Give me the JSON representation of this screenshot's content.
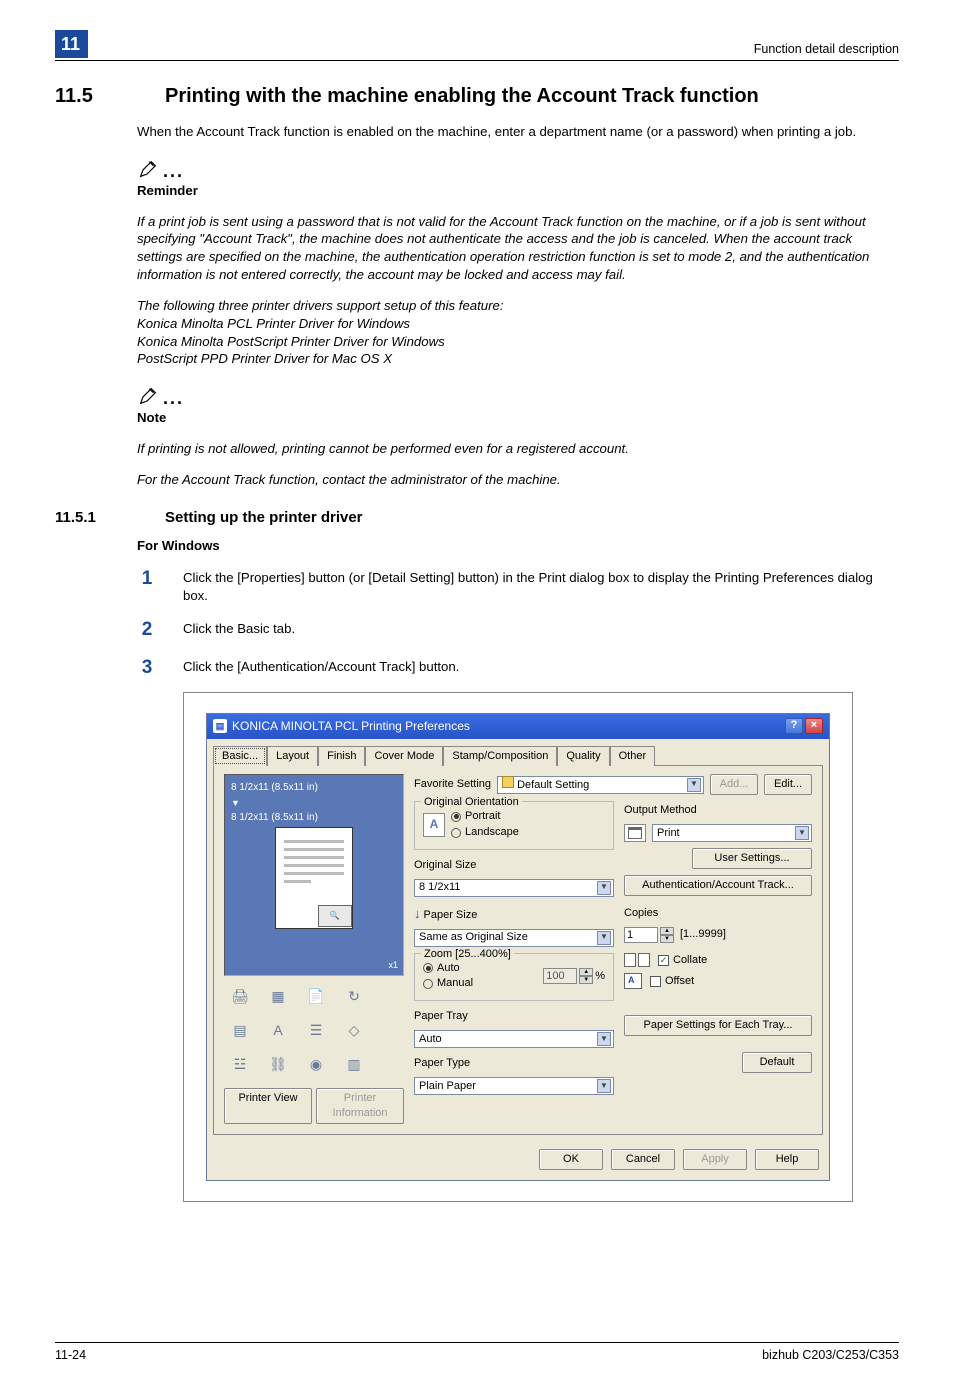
{
  "header": {
    "chapter": "11",
    "right": "Function detail description"
  },
  "sec": {
    "num": "11.5",
    "title": "Printing with the machine enabling the Account Track function",
    "intro": "When the Account Track function is enabled on the machine, enter a department name (or a password) when printing a job."
  },
  "reminder": {
    "label": "Reminder",
    "p1": "If a print job is sent using a password that is not valid for the Account Track function on the machine, or if a job is sent without specifying \"Account Track\", the machine does not authenticate the access and the job is canceled. When the account track settings are specified on the machine, the authentication operation restriction function is set to mode 2, and the authentication information is not entered correctly, the account may be locked and access may fail.",
    "p2": "The following three printer drivers support setup of this feature:",
    "d1": "Konica Minolta PCL Printer Driver for Windows",
    "d2": "Konica Minolta PostScript Printer Driver for Windows",
    "d3": "PostScript PPD Printer Driver for Mac OS X"
  },
  "note": {
    "label": "Note",
    "p1": "If printing is not allowed, printing cannot be performed even for a registered account.",
    "p2": "For the Account Track function, contact the administrator of the machine."
  },
  "sub": {
    "num": "11.5.1",
    "title": "Setting up the printer driver",
    "h3": "For Windows",
    "steps": {
      "s1": "Click the [Properties] button (or [Detail Setting] button) in the Print dialog box to display the Printing Preferences dialog box.",
      "s2": "Click the Basic tab.",
      "s3": "Click the [Authentication/Account Track] button."
    }
  },
  "dlg": {
    "title": "KONICA MINOLTA PCL Printing Preferences",
    "tabs": [
      "Basic...",
      "Layout",
      "Finish",
      "Cover Mode",
      "Stamp/Composition",
      "Quality",
      "Other"
    ],
    "fav_label": "Favorite Setting",
    "fav_value": "Default Setting",
    "add": "Add...",
    "edit": "Edit...",
    "preview_size1": "8 1/2x11 (8.5x11 in)",
    "preview_size2": "8 1/2x11 (8.5x11 in)",
    "x1": "x1",
    "printer_view": "Printer View",
    "printer_info": "Printer Information",
    "orient": {
      "title": "Original Orientation",
      "portrait": "Portrait",
      "landscape": "Landscape"
    },
    "osize_label": "Original Size",
    "osize_value": "8 1/2x11",
    "psize_label": "Paper Size",
    "psize_value": "Same as Original Size",
    "zoom": {
      "title": "Zoom [25...400%]",
      "auto": "Auto",
      "manual": "Manual",
      "value": "100",
      "pct": "%"
    },
    "tray_label": "Paper Tray",
    "tray_value": "Auto",
    "type_label": "Paper Type",
    "type_value": "Plain Paper",
    "out_label": "Output Method",
    "out_value": "Print",
    "user_settings": "User Settings...",
    "auth": "Authentication/Account Track...",
    "copies_label": "Copies",
    "copies_value": "1",
    "copies_range": "[1...9999]",
    "collate": "Collate",
    "offset": "Offset",
    "paper_settings": "Paper Settings for Each Tray...",
    "default": "Default",
    "ok": "OK",
    "cancel": "Cancel",
    "apply": "Apply",
    "help": "Help"
  },
  "footer": {
    "left": "11-24",
    "right": "bizhub C203/C253/C353"
  }
}
